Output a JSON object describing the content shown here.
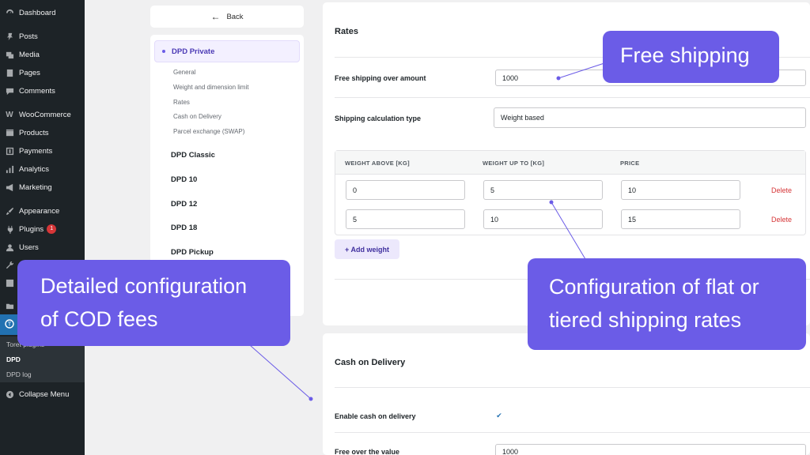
{
  "wp_menu": {
    "items": [
      {
        "label": "Dashboard",
        "icon": "dashboard-icon"
      },
      {
        "label": "Posts",
        "icon": "pin-icon"
      },
      {
        "label": "Media",
        "icon": "media-icon"
      },
      {
        "label": "Pages",
        "icon": "pages-icon"
      },
      {
        "label": "Comments",
        "icon": "comment-icon"
      },
      {
        "label": "WooCommerce",
        "icon": "woo-icon"
      },
      {
        "label": "Products",
        "icon": "products-icon"
      },
      {
        "label": "Payments",
        "icon": "payments-icon"
      },
      {
        "label": "Analytics",
        "icon": "analytics-icon"
      },
      {
        "label": "Marketing",
        "icon": "megaphone-icon"
      },
      {
        "label": "Appearance",
        "icon": "brush-icon"
      },
      {
        "label": "Plugins",
        "icon": "plug-icon"
      },
      {
        "label": "Users",
        "icon": "user-icon"
      }
    ],
    "plugins_badge": "1",
    "submenu": [
      "Toret plugins",
      "DPD",
      "DPD log"
    ],
    "collapse_label": "Collapse Menu"
  },
  "left_panel": {
    "back_label": "Back",
    "active_item": "DPD Private",
    "sub_items": [
      "General",
      "Weight and dimension limit",
      "Rates",
      "Cash on Delivery",
      "Parcel exchange (SWAP)"
    ],
    "main_items": [
      "DPD Classic",
      "DPD 10",
      "DPD 12",
      "DPD 18",
      "DPD Pickup"
    ]
  },
  "rates": {
    "title": "Rates",
    "free_shipping_label": "Free shipping over amount",
    "free_shipping_value": "1000",
    "calc_type_label": "Shipping calculation type",
    "calc_type_value": "Weight based",
    "table_headers": [
      "WEIGHT ABOVE [KG]",
      "WEIGHT UP TO [KG]",
      "PRICE"
    ],
    "rows": [
      {
        "above": "0",
        "upto": "5",
        "price": "10",
        "delete": "Delete"
      },
      {
        "above": "5",
        "upto": "10",
        "price": "15",
        "delete": "Delete"
      }
    ],
    "add_weight_label": "+ Add weight"
  },
  "cod": {
    "title": "Cash on Delivery",
    "enable_label": "Enable cash on delivery",
    "free_over_label": "Free over the value",
    "free_over_value": "1000"
  },
  "callouts": {
    "free_shipping": "Free shipping",
    "cod_line1": "Detailed configuration",
    "cod_line2": "of COD fees",
    "rates_line1": "Configuration of flat or",
    "rates_line2": "tiered shipping rates"
  },
  "colors": {
    "accent": "#6b5ce7",
    "wp_sidebar": "#1d2327",
    "wp_active": "#2271b1",
    "delete": "#d63638"
  }
}
